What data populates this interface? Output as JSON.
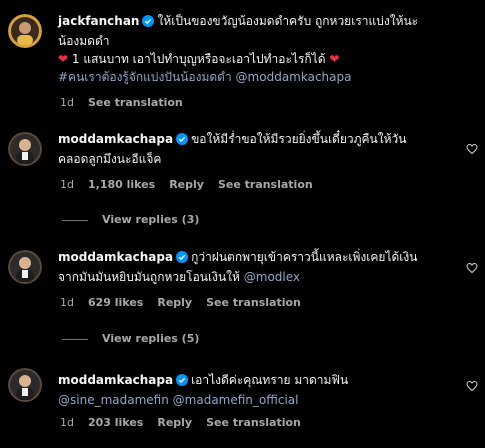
{
  "comments": [
    {
      "username": "jackfanchan",
      "text_line1": "ให้เป็นของขวัญน้องมดดำครับ ถูกหวยเราแบ่งให้นะ",
      "text_line2": "น้องมดดำ",
      "text_line3": "1 แสนบาท เอาไปทำบุญหรือจะเอาไปทำอะไรก็ได้",
      "hashtag": "#คนเราต้องรู้จักแบ่งปันน้องมดดำ",
      "mention": "@moddamkachapa",
      "time": "1d",
      "see_translation": "See translation"
    },
    {
      "username": "moddamkachapa",
      "text_line1": "ขอให้มีร่ำขอให้มีรวยยิ่งขึ้นเดี๋ยวภูคืนให้วัน",
      "text_line2": "คลอดลูกมึงนะอีแจ็ค",
      "time": "1d",
      "likes": "1,180 likes",
      "reply": "Reply",
      "see_translation": "See translation",
      "view_replies": "View replies (3)"
    },
    {
      "username": "moddamkachapa",
      "text_line1": "กูว่าฝนตกพายุเข้าคราวนี้แหละเพิ่งเคยได้เงิน",
      "text_line2": "จากมันมันหยิบมันถูกหวยโอนเงินให้",
      "mention": "@modlex",
      "time": "1d",
      "likes": "629 likes",
      "reply": "Reply",
      "see_translation": "See translation",
      "view_replies": "View replies (5)"
    },
    {
      "username": "moddamkachapa",
      "text_line1": "เอาไงดีค่ะคุณทราย มาดามฟิน",
      "mention1": "@sine_madamefin",
      "mention2": "@madamefin_official",
      "time": "1d",
      "likes": "203 likes",
      "reply": "Reply",
      "see_translation": "See translation"
    }
  ],
  "icons": {
    "verified": "verified-badge-icon",
    "like": "heart-outline-icon",
    "red_heart": "red-heart-emoji-icon"
  },
  "colors": {
    "background": "#000000",
    "text": "#f5f5f5",
    "secondary": "#a8a8a8",
    "link": "#8fa6c8",
    "verified": "#0095f6",
    "red_heart": "#ed2f45"
  }
}
